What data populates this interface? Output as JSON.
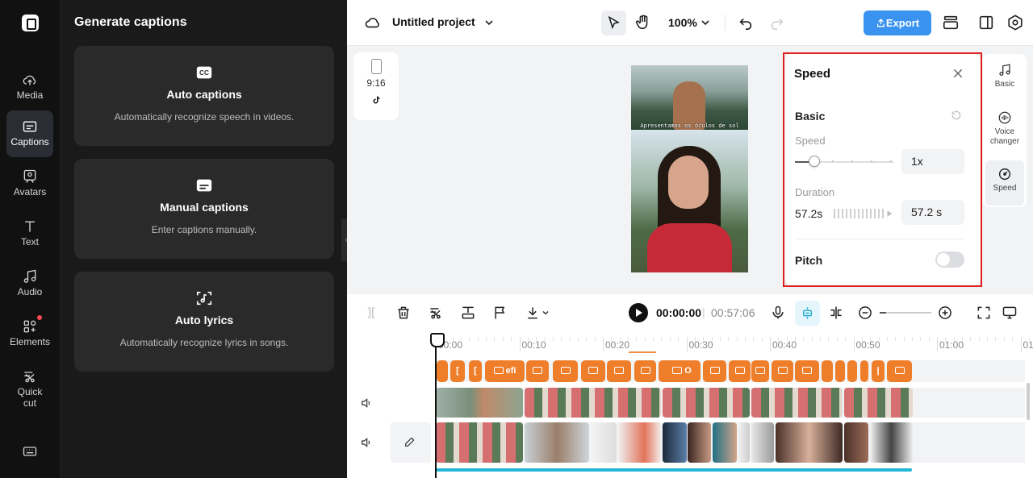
{
  "left_rail": {
    "items": [
      {
        "label": "Media",
        "icon": "cloud-upload-icon"
      },
      {
        "label": "Captions",
        "icon": "captions-icon",
        "active": true
      },
      {
        "label": "Avatars",
        "icon": "avatar-icon"
      },
      {
        "label": "Text",
        "icon": "text-icon"
      },
      {
        "label": "Audio",
        "icon": "music-icon"
      },
      {
        "label": "Elements",
        "icon": "elements-icon",
        "badge": true
      },
      {
        "label": "Quick cut",
        "icon": "quick-cut-icon"
      }
    ],
    "bottom_icon": "keyboard-icon"
  },
  "captions_panel": {
    "title": "Generate captions",
    "cards": [
      {
        "title": "Auto captions",
        "desc": "Automatically recognize speech in videos.",
        "icon": "cc-icon"
      },
      {
        "title": "Manual captions",
        "desc": "Enter captions manually.",
        "icon": "subtitle-icon"
      },
      {
        "title": "Auto lyrics",
        "desc": "Automatically recognize lyrics in songs.",
        "icon": "lyrics-icon"
      }
    ]
  },
  "header": {
    "project_title": "Untitled project",
    "zoom": "100%",
    "export_label": "Export"
  },
  "canvas": {
    "aspect_ratio": "9:16",
    "caption_text": "Apresentamos os óculos de sol"
  },
  "speed_panel": {
    "title": "Speed",
    "section": "Basic",
    "speed_label": "Speed",
    "speed_value": "1x",
    "speed_slider_fraction": 0.2,
    "duration_label": "Duration",
    "duration_original": "57.2s",
    "duration_value": "57.2 s",
    "pitch_label": "Pitch",
    "pitch_on": false
  },
  "right_tabs": [
    {
      "label": "Basic",
      "icon": "music-note-icon"
    },
    {
      "label": "Voice changer",
      "icon": "voice-changer-icon"
    },
    {
      "label": "Speed",
      "icon": "speed-icon",
      "active": true
    }
  ],
  "timeline": {
    "current_time": "00:00:00",
    "total_time": "00:57:06",
    "ruler": [
      "00:00",
      "00:10",
      "00:20",
      "00:30",
      "00:40",
      "00:50",
      "01:00",
      "01"
    ],
    "caption_clip_text": [
      "efi",
      "O"
    ]
  },
  "colors": {
    "accent": "#3b93f0",
    "caption_clip": "#ef7e2b",
    "highlight": "#e02020",
    "audio": "#22b7d6"
  }
}
